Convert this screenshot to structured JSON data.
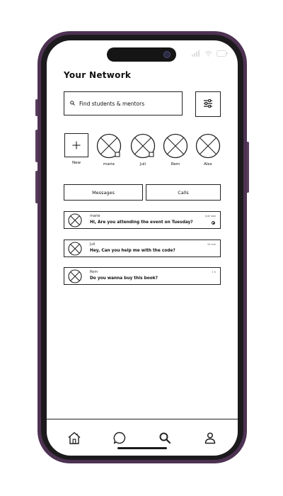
{
  "page": {
    "title": "Your Network"
  },
  "search": {
    "placeholder": "Find students & mentors",
    "icon": "search-icon"
  },
  "filter": {
    "icon": "sliders-icon"
  },
  "contacts": [
    {
      "label": "New",
      "type": "add"
    },
    {
      "label": "marie",
      "type": "avatar",
      "badge": true
    },
    {
      "label": "Juli",
      "type": "avatar",
      "badge": true
    },
    {
      "label": "Rem",
      "type": "avatar",
      "badge": false
    },
    {
      "label": "Alex",
      "type": "avatar",
      "badge": false
    }
  ],
  "tabs": {
    "messages": "Messages",
    "calls": "Calls"
  },
  "messages": [
    {
      "name": "marie",
      "text": "Hi, Are you attending the event on Tuesday?",
      "time": "Just now",
      "unread": true
    },
    {
      "name": "Juli",
      "text": "Hey, Can you help me with the code?",
      "time": "10 min",
      "unread": false
    },
    {
      "name": "Rem",
      "text": "Do you wanna buy this book?",
      "time": "1 h",
      "unread": false
    }
  ],
  "nav": [
    {
      "name": "home",
      "icon": "home-icon"
    },
    {
      "name": "chat",
      "icon": "chat-icon"
    },
    {
      "name": "search",
      "icon": "search-icon"
    },
    {
      "name": "profile",
      "icon": "user-icon"
    }
  ],
  "colors": {
    "frame": "#4d3252",
    "bezel": "#1c1a1d",
    "ink": "#222222",
    "screen": "#ffffff"
  }
}
